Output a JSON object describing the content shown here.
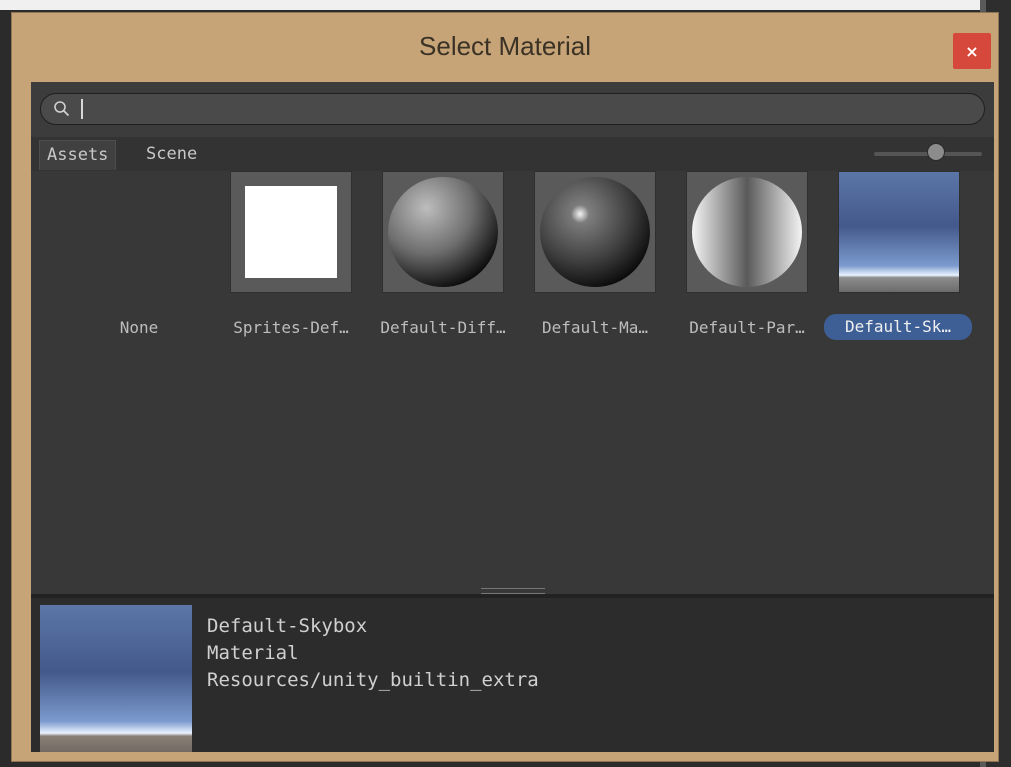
{
  "window": {
    "title": "Select Material",
    "close_label": "×"
  },
  "search": {
    "value": "",
    "placeholder": ""
  },
  "tabs": [
    {
      "label": "Assets",
      "active": true
    },
    {
      "label": "Scene",
      "active": false
    }
  ],
  "zoom_slider": {
    "level": 0.6
  },
  "items": [
    {
      "label": "None",
      "icon": "none",
      "selected": false
    },
    {
      "label": "Sprites-Def…",
      "icon": "white-square",
      "selected": false
    },
    {
      "label": "Default-Diff…",
      "icon": "matte-sphere",
      "selected": false
    },
    {
      "label": "Default-Ma…",
      "icon": "glossy-sphere",
      "selected": false
    },
    {
      "label": "Default-Par…",
      "icon": "particle-sphere",
      "selected": false
    },
    {
      "label": "Default-Sk…",
      "icon": "skybox",
      "selected": true
    }
  ],
  "preview": {
    "name": "Default-Skybox",
    "type": "Material",
    "path": "Resources/unity_builtin_extra"
  },
  "colors": {
    "window_frame": "#c6a478",
    "close_button": "#d6473c",
    "panel": "#383838",
    "selection": "#3e5f96"
  }
}
